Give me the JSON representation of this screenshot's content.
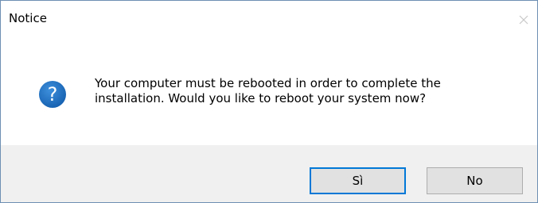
{
  "dialog": {
    "title": "Notice",
    "message_line1": "Your computer must be rebooted in order to complete the",
    "message_line2": "installation. Would you like to reboot your system now?",
    "icon": "question-icon",
    "close_icon": "close-icon",
    "buttons": {
      "yes_label": "Sì",
      "no_label": "No"
    },
    "colors": {
      "icon_blue": "#1c6fbf",
      "focus_border": "#0078d7",
      "footer_bg": "#f0f0f0"
    }
  }
}
